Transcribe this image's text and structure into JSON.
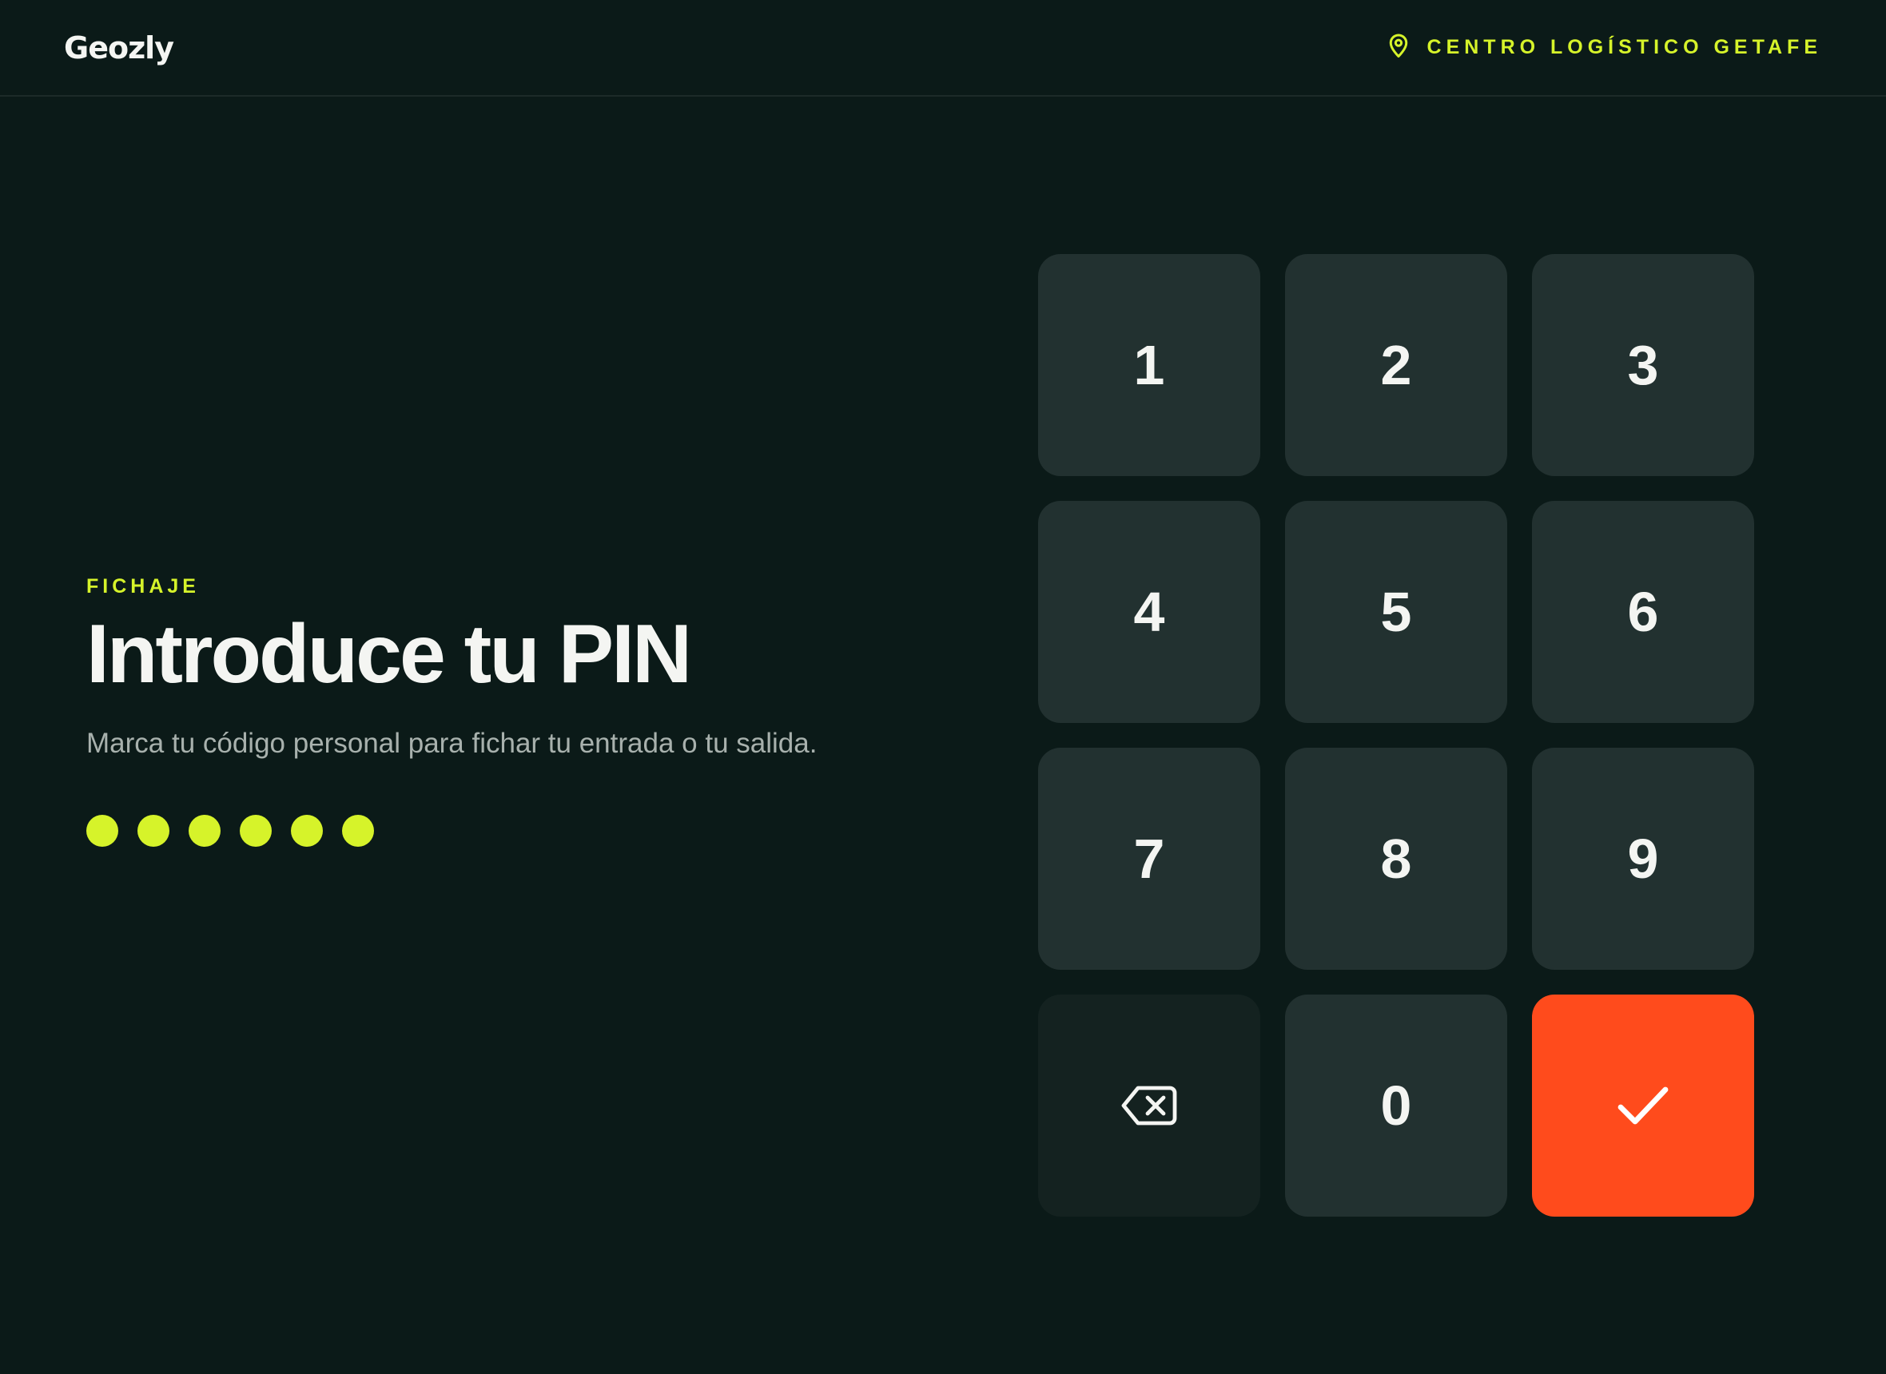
{
  "header": {
    "brand": "Geozly",
    "location": "CENTRO LOGÍSTICO GETAFE",
    "location_icon": "map-pin-icon"
  },
  "main": {
    "eyebrow": "FICHAJE",
    "title": "Introduce tu PIN",
    "subtitle": "Marca tu código personal para fichar tu entrada o tu salida.",
    "pin_length": 6,
    "pin_filled": 6
  },
  "keypad": {
    "keys": [
      "1",
      "2",
      "3",
      "4",
      "5",
      "6",
      "7",
      "8",
      "9"
    ],
    "zero": "0",
    "delete_icon": "backspace-icon",
    "confirm_icon": "check-icon"
  },
  "colors": {
    "background": "#0b1a18",
    "accent": "#d6f32a",
    "key": "#223130",
    "confirm": "#ff4b1c"
  }
}
